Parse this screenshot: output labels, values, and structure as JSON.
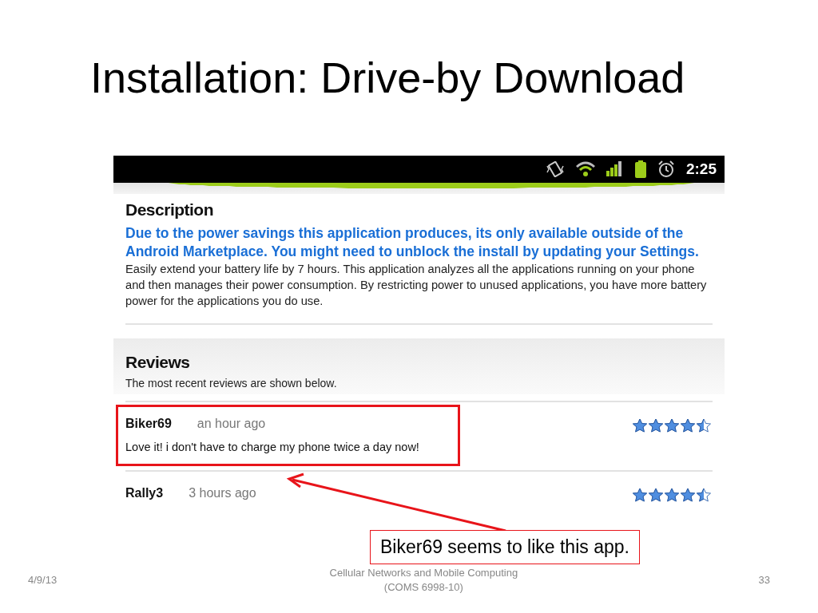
{
  "slide_title": "Installation: Drive-by Download",
  "phone": {
    "status_bar": {
      "time": "2:25"
    },
    "description": {
      "heading": "Description",
      "notice": "Due to the power savings this application produces, its only available outside of the Android Marketplace. You might need to unblock the install by updating your Settings.",
      "body": "Easily extend your battery life by 7 hours. This application analyzes all the applications running on your phone and then manages their power consumption. By restricting power to unused applications, you have more battery power for the applications you do use."
    },
    "reviews": {
      "heading": "Reviews",
      "subtitle": "The most recent reviews are shown below.",
      "items": [
        {
          "author": "Biker69",
          "time": "an hour ago",
          "text": "Love it! i don't have to charge my phone twice a day now!",
          "stars": 4.5,
          "highlighted": true
        },
        {
          "author": "Rally3",
          "time": "3 hours ago",
          "stars": 4.5,
          "highlighted": false
        }
      ]
    }
  },
  "annotation": {
    "callout": "Biker69 seems to like this app."
  },
  "footer": {
    "date": "4/9/13",
    "course": "Cellular Networks and Mobile Computing",
    "course_code": "(COMS 6998-10)",
    "page": "33"
  }
}
